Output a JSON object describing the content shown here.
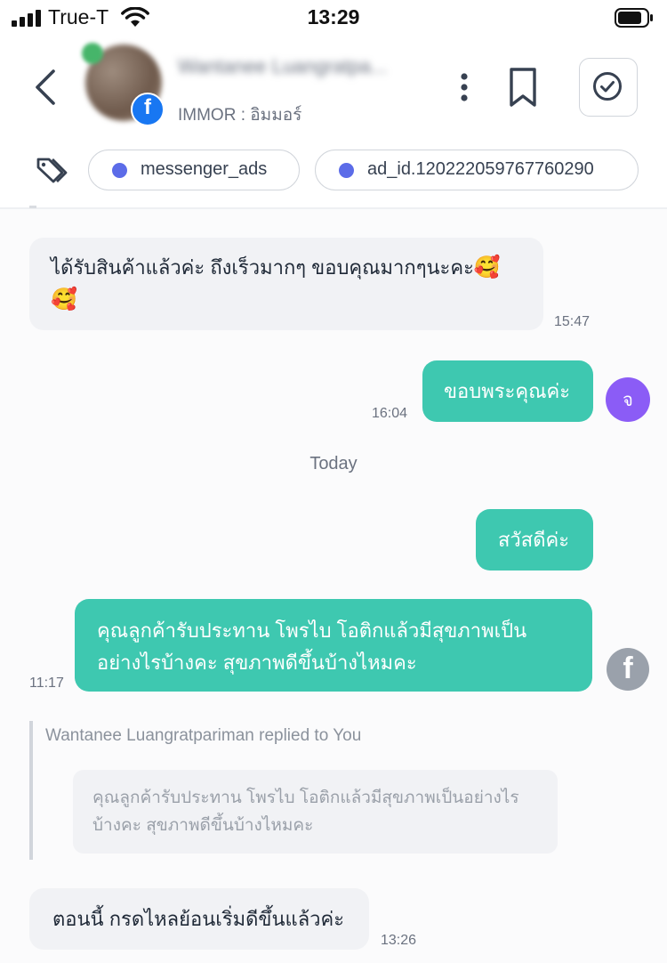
{
  "status_bar": {
    "carrier": "True-T",
    "time": "13:29"
  },
  "header": {
    "contact_name": "Wantanee Luangratpa...",
    "subtitle": "IMMOR : อิมมอร์",
    "channel_icon": "facebook-icon",
    "channel_glyph": "f"
  },
  "tags": [
    {
      "label": "messenger_ads",
      "color": "#5c6ce8"
    },
    {
      "label": "ad_id.120222059767760290",
      "color": "#5c6ce8"
    }
  ],
  "messages": {
    "m1": {
      "line1": "ได้รับสินค้าแล้วค่ะ ถึงเร็วมากๆ ขอบคุณมากๆนะคะ",
      "emoji": "🥰",
      "time": "15:47"
    },
    "m2": {
      "text": "ขอบพระคุณค่ะ",
      "time": "16:04",
      "agent_initial": "จ"
    },
    "today_label": "Today",
    "m3": {
      "text": "สวัสดีค่ะ"
    },
    "m4": {
      "line1": "คุณลูกค้ารับประทาน โพรไบ โอติกแล้วมีสุขภาพเป็น",
      "line2": "อย่างไรบ้างคะ สุขภาพดีขึ้นบ้างไหมคะ",
      "time": "11:17",
      "sender_glyph": "f"
    },
    "reply": {
      "caption": "Wantanee Luangratpariman replied to You",
      "quote_line1": "คุณลูกค้ารับประทาน โพรไบ โอติกแล้วมีสุขภาพเป็นอย่างไร",
      "quote_line2": "บ้างคะ สุขภาพดีขึ้นบ้างไหมคะ"
    },
    "m5": {
      "text": "ตอนนี้ กรดไหลย้อนเริ่มดีขึ้นแล้วค่ะ",
      "time": "13:26"
    }
  },
  "colors": {
    "outgoing_bubble": "#3ec8b0",
    "incoming_bubble": "#f1f2f5",
    "agent_avatar": "#8b5cf6",
    "facebook_blue": "#1877f2"
  }
}
